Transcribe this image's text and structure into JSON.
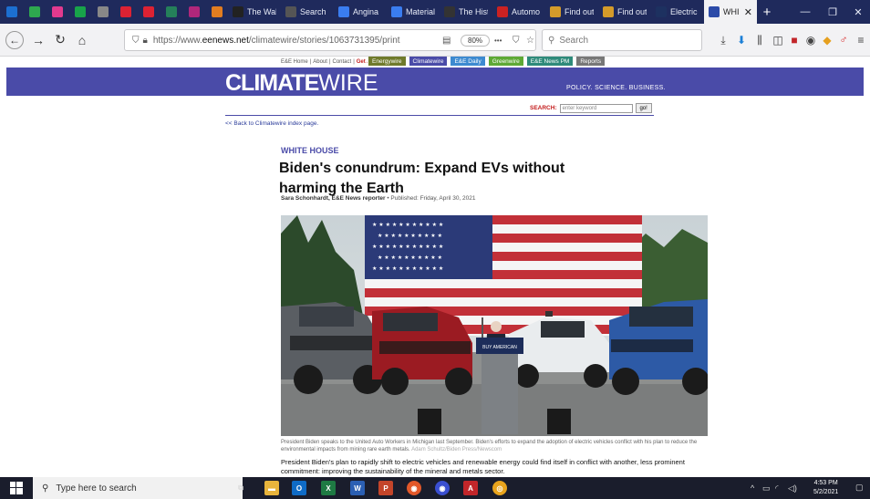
{
  "browser": {
    "tabs": [
      {
        "title": "",
        "icon": "pi-icon",
        "color": "#1c6fd1"
      },
      {
        "title": "",
        "icon": "arrow-icon",
        "color": "#2ea84f"
      },
      {
        "title": "",
        "icon": "flower-icon",
        "color": "#e23a8e"
      },
      {
        "title": "",
        "icon": "circle-icon",
        "color": "#18a34a"
      },
      {
        "title": "",
        "icon": "grid-icon",
        "color": "#888"
      },
      {
        "title": "",
        "icon": "flag-icon",
        "color": "#d23"
      },
      {
        "title": "",
        "icon": "tab-icon",
        "color": "#d23"
      },
      {
        "title": "",
        "icon": "nh-icon",
        "color": "#25805a"
      },
      {
        "title": "",
        "icon": "book-icon",
        "color": "#b0277b"
      },
      {
        "title": "",
        "icon": "star-icon",
        "color": "#e27d20"
      },
      {
        "title": "The Wal",
        "icon": "wsj-icon",
        "color": "#222"
      },
      {
        "title": "Search",
        "icon": "dot-icon",
        "color": "#555"
      },
      {
        "title": "Angina",
        "icon": "g-icon",
        "color": "#3a7df0"
      },
      {
        "title": "Material",
        "icon": "g-icon",
        "color": "#3a7df0"
      },
      {
        "title": "The Hist",
        "icon": "h-icon",
        "color": "#333"
      },
      {
        "title": "Automo",
        "icon": "circle-icon",
        "color": "#c22"
      },
      {
        "title": "Find out",
        "icon": "leaf-icon",
        "color": "#d49b2a"
      },
      {
        "title": "Find out",
        "icon": "leaf-icon",
        "color": "#d49b2a"
      },
      {
        "title": "Electric",
        "icon": "f-icon",
        "color": "#1d3160"
      },
      {
        "title": "WHI",
        "icon": "ee-icon",
        "color": "#2c4ba8",
        "active": true
      }
    ],
    "new_tab": "+",
    "window": {
      "minimize": "—",
      "restore": "❐",
      "close": "✕"
    },
    "url_prefix": "https://www.",
    "url_host": "eenews.net",
    "url_path": "/climatewire/stories/1063731395/print",
    "zoom": "80%",
    "search_placeholder": "Search",
    "menu_dots": "•••"
  },
  "site": {
    "topnav": [
      "E&E Home",
      "About",
      "Contact",
      "Get Access"
    ],
    "sitetabs": [
      {
        "label": "Energywire",
        "color": "#6f7a2b"
      },
      {
        "label": "Climatewire",
        "color": "#4a4ba8"
      },
      {
        "label": "E&E Daily",
        "color": "#3d8ad0"
      },
      {
        "label": "Greenwire",
        "color": "#5ea935"
      },
      {
        "label": "E&E News PM",
        "color": "#2e8a7a"
      },
      {
        "label": "Reports",
        "color": "#777"
      }
    ],
    "logo_bold": "CLIMATE",
    "logo_light": "WIRE",
    "tagline": "POLICY. SCIENCE. BUSINESS.",
    "search_label": "SEARCH:",
    "search_placeholder": "enter keyword",
    "search_go": "go!",
    "back_link": "<< Back to Climatewire index page."
  },
  "article": {
    "section": "WHITE HOUSE",
    "headline": "Biden's conundrum: Expand EVs without harming the Earth",
    "author": "Sara Schonhardt, E&E News reporter",
    "published": "• Published: Friday, April 30, 2021",
    "podium_sign": "BUY AMERICAN",
    "caption": "President Biden speaks to the United Auto Workers in Michigan last September. Biden's efforts to expand the adoption of electric vehicles conflict with his plan to reduce the environmental impacts from mining rare earth metals.",
    "credit": "Adam Schultz/Biden Press/Newscom",
    "lede": "President Biden's plan to rapidly shift to electric vehicles and renewable energy could find itself in conflict with another, less prominent commitment: improving the sustainability of the mineral and metals sector."
  },
  "taskbar": {
    "search_placeholder": "Type here to search",
    "time": "4:53 PM",
    "date": "5/2/2021"
  }
}
